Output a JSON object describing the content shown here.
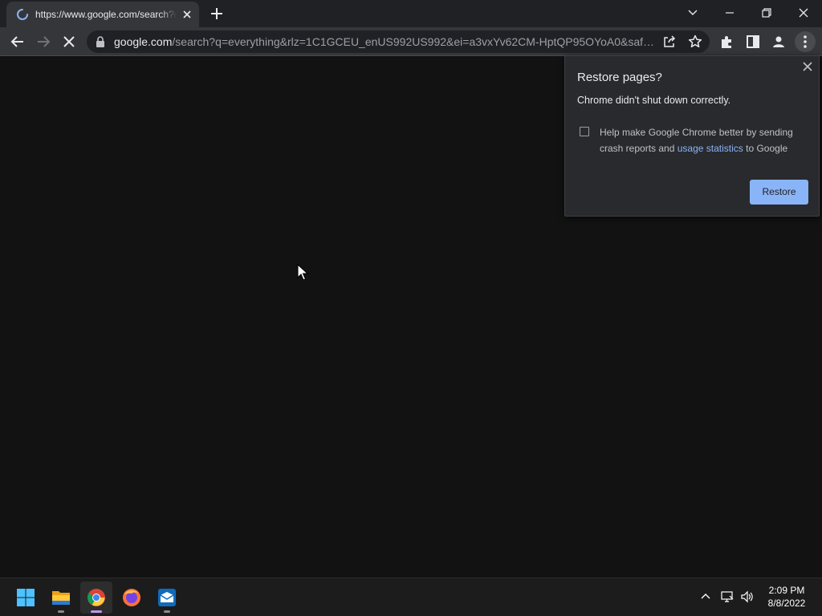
{
  "tab": {
    "title": "https://www.google.com/search?q=everything"
  },
  "omnibox": {
    "host": "google.com",
    "path": "/search?q=everything&rlz=1C1GCEU_enUS992US992&ei=a3vxYv62CM-HptQP95OYoA0&safe=..."
  },
  "icons": {
    "tab": [
      "loading-spinner-icon",
      "close-icon",
      "plus-icon"
    ],
    "window": [
      "chevron-down-icon",
      "minimize-icon",
      "restore-icon",
      "close-icon"
    ],
    "toolbar": [
      "back-arrow-icon",
      "forward-arrow-icon",
      "stop-loading-icon",
      "lock-icon",
      "share-icon",
      "star-icon",
      "puzzle-icon",
      "side-panel-icon",
      "profile-icon",
      "kebab-menu-icon"
    ],
    "taskbar": [
      "windows-start-icon",
      "folder-icon",
      "chrome-icon",
      "firefox-icon",
      "mail-icon"
    ],
    "tray": [
      "chevron-up-icon",
      "network-icon",
      "speaker-icon"
    ]
  },
  "restore_bubble": {
    "title": "Restore pages?",
    "message": "Chrome didn't shut down correctly.",
    "help_prefix": "Help make Google Chrome better by sending crash reports and",
    "help_link": "usage statistics",
    "help_suffix": "to Google",
    "checkbox_checked": false,
    "button_label": "Restore"
  },
  "taskbar": {
    "clock_time": "2:09 PM",
    "clock_date": "8/8/2022"
  },
  "colors": {
    "accent": "#8ab4f8",
    "tab_active_indicator": "#c295e6",
    "page_background": "#121212"
  }
}
